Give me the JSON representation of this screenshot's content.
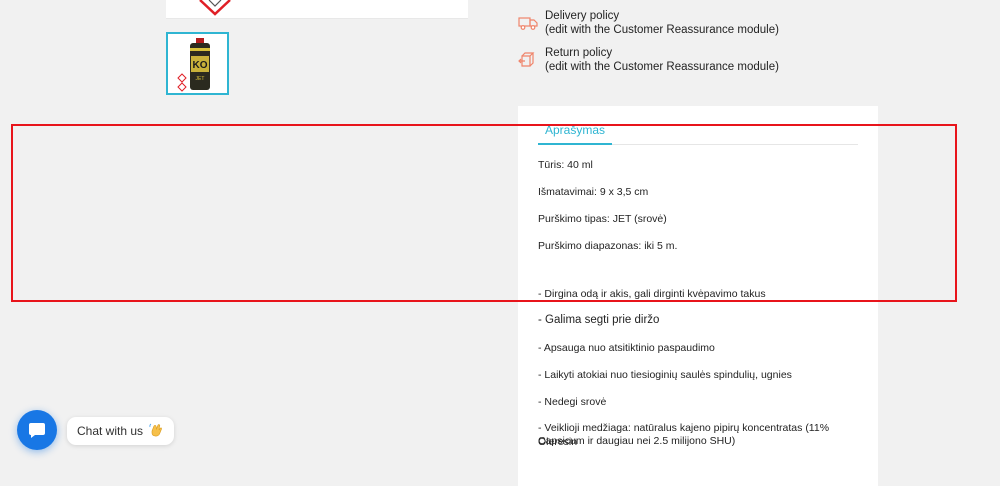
{
  "reassurance": {
    "items": [
      {
        "title": "Delivery policy",
        "subtitle": "(edit with the Customer Reassurance module)",
        "icon": "truck-icon"
      },
      {
        "title": "Return policy",
        "subtitle": "(edit with the Customer Reassurance module)",
        "icon": "return-box-icon"
      }
    ]
  },
  "thumbnail": {
    "icon": "pepper-spray-product-thumbnail",
    "label_text": "KO",
    "sub_text": "JET"
  },
  "description": {
    "tab_label": "Aprašymas",
    "lines": [
      "Tūris: 40 ml",
      "Išmatavimai: 9 x 3,5 cm",
      "Purškimo tipas: JET (srovė)",
      "Purškimo diapazonas: iki 5 m.",
      "- Dirgina odą ir akis, gali dirginti kvėpavimo takus",
      "- Galima segti prie diržo",
      "- Apsauga nuo atsitiktinio paspaudimo",
      "- Laikyti atokiai nuo tiesioginių saulės spindulių, ugnies",
      "- Nedegi srovė",
      "- Veiklioji medžiaga: natūralus kajeno pipirų koncentratas (11% Oleresin",
      "Capsicum ir daugiau nei 2.5 milijono SHU)"
    ]
  },
  "chat": {
    "label": "Chat with us",
    "icon": "chat-icon",
    "emoji_icon": "waving-hand-icon"
  },
  "colors": {
    "accent": "#2fb5d2",
    "chat_blue": "#1877e5",
    "highlight_red": "#e8141b",
    "reassurance_icon": "#f0846a"
  }
}
